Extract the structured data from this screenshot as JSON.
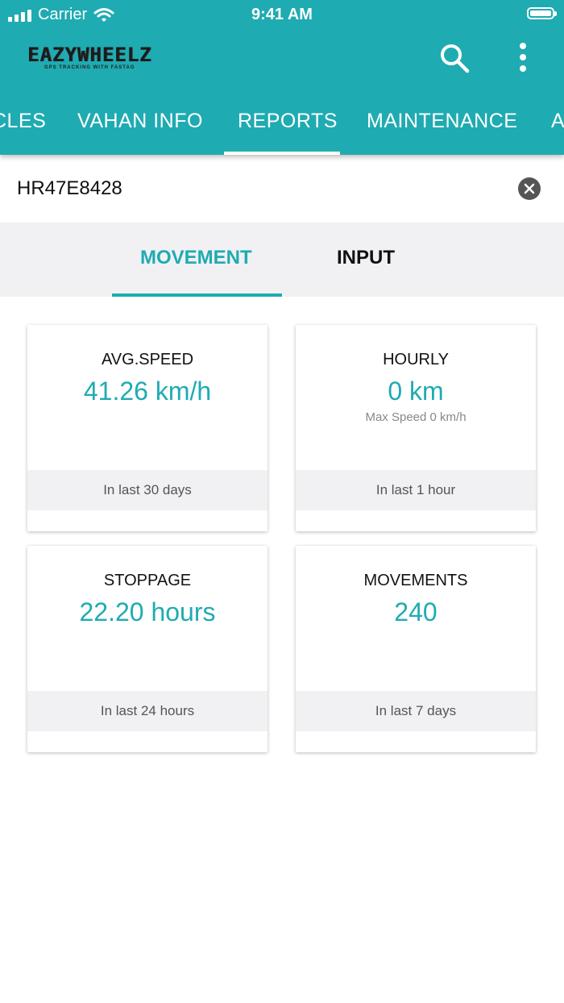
{
  "status_bar": {
    "carrier": "Carrier",
    "time": "9:41 AM"
  },
  "app": {
    "logo_text": "EAZYWHEELZ",
    "logo_tagline": "GPS TRACKING WITH FASTAG"
  },
  "tabs": [
    {
      "label": "CLES"
    },
    {
      "label": "VAHAN INFO"
    },
    {
      "label": "REPORTS",
      "selected": true
    },
    {
      "label": "MAINTENANCE"
    },
    {
      "label": "A"
    }
  ],
  "vehicle": {
    "plate": "HR47E8428"
  },
  "subtabs": [
    {
      "label": "MOVEMENT",
      "selected": true
    },
    {
      "label": "INPUT"
    }
  ],
  "cards": [
    {
      "title": "AVG.SPEED",
      "value": "41.26 km/h",
      "sub": "",
      "footer": "In last 30 days"
    },
    {
      "title": "HOURLY",
      "value": "0 km",
      "sub": "Max Speed 0 km/h",
      "footer": "In last 1 hour"
    },
    {
      "title": "STOPPAGE",
      "value": "22.20 hours",
      "sub": "",
      "footer": "In last 24 hours"
    },
    {
      "title": "MOVEMENTS",
      "value": "240",
      "sub": "",
      "footer": "In last 7 days"
    }
  ],
  "icons": {
    "search": "search-icon",
    "more": "more-vertical-icon",
    "clear": "close-circle-icon",
    "wifi": "wifi-icon",
    "signal": "signal-icon",
    "battery": "battery-icon"
  },
  "colors": {
    "primary": "#1fabb2",
    "panel": "#f1f1f3",
    "text": "#111111"
  }
}
